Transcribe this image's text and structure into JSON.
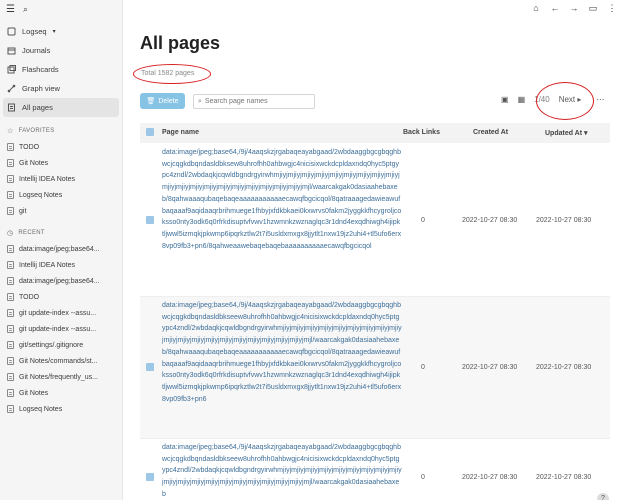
{
  "sidebar": {
    "graph_name": "Logseq",
    "nav": [
      {
        "label": "Journals",
        "icon": "calendar-icon"
      },
      {
        "label": "Flashcards",
        "icon": "cards-icon"
      },
      {
        "label": "Graph view",
        "icon": "graph-icon"
      },
      {
        "label": "All pages",
        "icon": "pages-icon"
      }
    ],
    "favorites_label": "FAVORITES",
    "favorites": [
      "TODO",
      "Git Notes",
      "Intellij IDEA Notes",
      "Logseq Notes",
      "git"
    ],
    "recent_label": "RECENT",
    "recent": [
      "data:image/jpeg;base64...",
      "Intellij IDEA Notes",
      "data:image/jpeg;base64...",
      "TODO",
      "git update-index --assu...",
      "git update-index --assu...",
      "git/settings/.gitignore",
      "Git Notes/commands/st...",
      "Git Notes/frequently_us...",
      "Git Notes",
      "Logseq Notes"
    ]
  },
  "main": {
    "title": "All pages",
    "total": "Total 1582 pages",
    "delete_label": "Delete",
    "search_placeholder": "Search page names",
    "pager": "1/40",
    "next_label": "Next",
    "columns": {
      "name": "Page name",
      "links": "Back Links",
      "created": "Created At",
      "updated": "Updated At"
    },
    "rows": [
      {
        "name": "data:image/jpeg;base64,/9j/4aaqskzjrgabaqeayabgaad/2wbdaaggbgcgbqghbwcjcqgkdbqndasldbksew8uhrofhh0ahbwgjc4nicisixwckdcpldaxndq0hyc5ptgypc4zndl/2wbdaqkjcqwldbgndrgyirwhmjiyjmjiyjmjiyjmjiyjmjiyjmjiyjmjiyjmjiyjmjiyjmjiyjmjiyjmjiyjmjiyjmjiyjmjiyjmjiyjmjiyjmjiyjmjiyjmjl/waarcakgak0dasiaahebaxeb/8qahwaaaqubaqebaqeaaaaaaaaaaaecawqfbgcicqol/8qatraaagedawieawufbaqaaaf9aqidaaqrbrihmuege1fhbyjxfdkbkaei0kxwrvs0fakm2jyggkkfhcygroljcoksso0nty3odk6q0rfrkdisuptvfvwv1hzwmnkzwznaglqc3r1dnd4exqdhiwgh4ijipktljwwl5izmqkjpkwmp6ipqrkztlw2t7i5usldxmxgx8jjytlt1nxw19jz2uhi4+tl5ufo6erx8vp09fb3+pn6/8qahweaawebaqebaqebaaaaaaaaaaecawqfbgcicqol",
        "links": "0",
        "created": "2022-10-27 08:30",
        "updated": "2022-10-27 08:30"
      },
      {
        "name": "data:image/jpeg;base64,/9j/4aaqskzjrgabaqeayabgaad/2wbdaaggbgcgbqghbwcjcqgkdbqndasldbkseew8uhrofhh0ahbwgjc4nicisixwckdcpldaxndq0hyc5ptgypc4zndl/2wbdaqkjcqwldbgndrgyirwhmjiyjmjiyjmjiyjmjiyjmjiyjmjiyjmjiyjmjiyjmjiyjmjiyjmjiyjmjiyjmjiyjmjiyjmjiyjmjiyjmjiyjmjiyjmjiyjmjl/waarcakgak0dasiaahebaxeb/8qahwaaaqubaqebaqeaaaaaaaaaaaecawqfbgcicqol/8qatraaagedawieawufbaqaaaf9aqidaaqrbrihmuege1fhbyjxfdkbkaei0kxwrvs0fakm2jyggkkfhcygroljcoksso0nty3odk6q0rfrkdisuptvfvwv1hzwmnkzwznaglqc3r1dnd4exqdhiwgh4ijipktljwwl5izmqkjpkwmp6ipqrkztlw2t7i5usldxmxgx8jjytlt1nxw19jz2uhi4+tl5ufo6erx8vp09fb3+pn6",
        "links": "0",
        "created": "2022-10-27 08:30",
        "updated": "2022-10-27 08:30"
      },
      {
        "name": "data:image/jpeg;base64,/9j/4aaqskzjrgabaqeayabgaad/2wbdaaggbgcgbqghbwcjcqgkdbqndasldbkseew8uhrofhh0ahbwgjc4nicisixwckdcpldaxndq0hyc5ptgypc4zndl/2wbdaqkjcqwldbgndrgyirwhmjiyjmjiyjmjiyjmjiyjmjiyjmjiyjmjiyjmjiyjmjiyjmjiyjmjiyjmjiyjmjiyjmjiyjmjiyjmjiyjmjiyjmjiyjmjiyjmjl/waarcakgak0dasiaahebaxeb",
        "links": "0",
        "created": "2022-10-27 08:30",
        "updated": "2022-10-27 08:30"
      }
    ]
  },
  "colors": {
    "accent": "#86c3e4",
    "link": "#3e6f99",
    "annotation": "#d61f1f"
  }
}
